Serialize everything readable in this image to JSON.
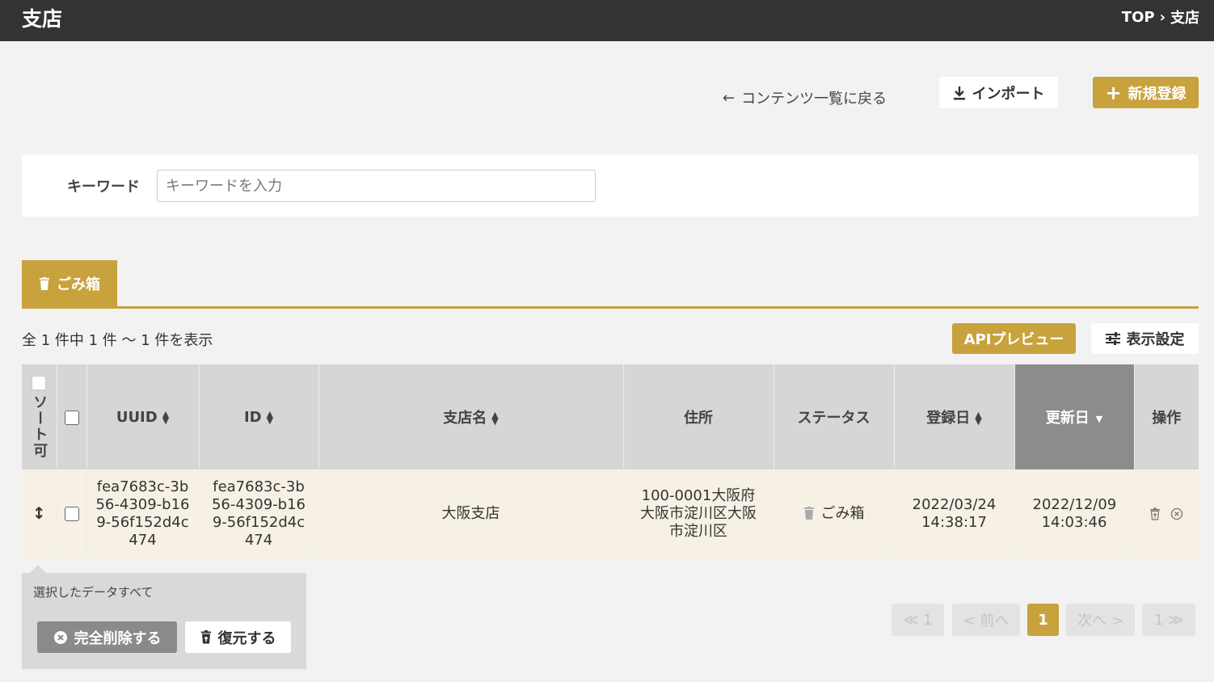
{
  "header": {
    "title": "支店",
    "breadcrumb": [
      "TOP",
      "支店"
    ]
  },
  "toolbar": {
    "back_label": "コンテンツ一覧に戻る",
    "import_label": "インポート",
    "new_label": "新規登録"
  },
  "search": {
    "label": "キーワード",
    "placeholder": "キーワードを入力",
    "value": ""
  },
  "tabs": [
    {
      "label": "ごみ箱",
      "active": true
    }
  ],
  "list": {
    "count_text": "全 1 件中 1 件 ～ 1 件を表示",
    "api_preview_label": "APIプレビュー",
    "display_settings_label": "表示設定",
    "columns": {
      "sortable": "ソート可",
      "uuid": "UUID",
      "id": "ID",
      "name": "支店名",
      "address": "住所",
      "status": "ステータス",
      "created": "登録日",
      "updated": "更新日",
      "actions": "操作"
    },
    "rows": [
      {
        "uuid": "fea7683c-3b56-4309-b169-56f152d4c474",
        "id": "fea7683c-3b56-4309-b169-56f152d4c474",
        "name": "大阪支店",
        "address": "100-0001大阪府大阪市淀川区大阪市淀川区",
        "status": "ごみ箱",
        "created": "2022/03/24 14:38:17",
        "updated": "2022/12/09 14:03:46"
      }
    ]
  },
  "bulk": {
    "text": "選択したデータすべて",
    "delete_label": "完全削除する",
    "restore_label": "復元する"
  },
  "pagination": {
    "first": "≪ 1",
    "prev": "< 前へ",
    "current": "1",
    "next": "次へ >",
    "last": "1 ≫"
  },
  "colors": {
    "gold": "#c8a23c",
    "header_bg": "#333333",
    "row_bg": "#f6f1e4",
    "active_col": "#8c8c8c"
  }
}
